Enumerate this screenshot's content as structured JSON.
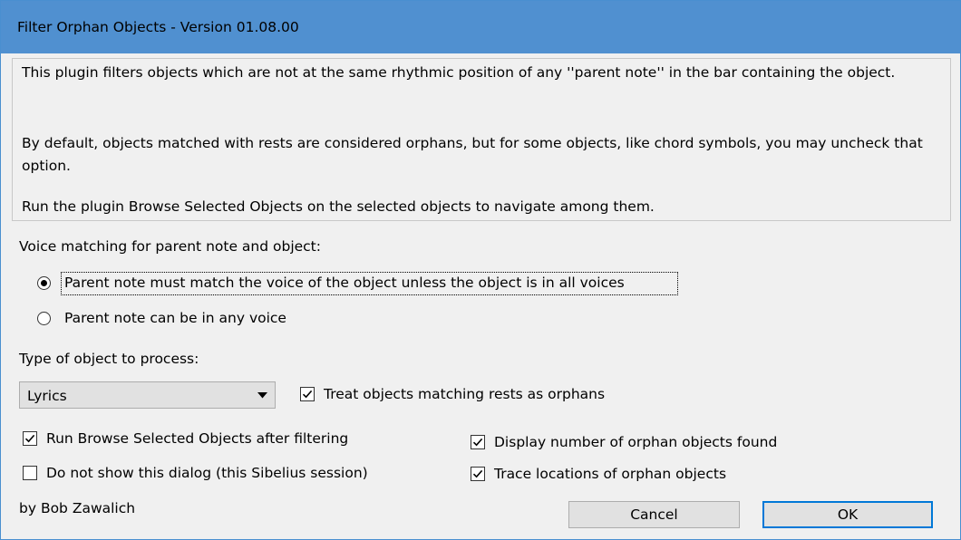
{
  "window": {
    "title": "Filter Orphan Objects - Version 01.08.00"
  },
  "info": {
    "paragraph1": "This plugin filters objects which are not at the same rhythmic position of any ''parent note'' in the bar containing the object.",
    "paragraph2": "By default, objects matched with rests are considered orphans, but for some objects, like chord symbols, you may uncheck that option.",
    "paragraph3": "Run the plugin Browse Selected Objects on the selected objects to navigate among them."
  },
  "voice": {
    "label": "Voice matching for parent note and object:",
    "options": [
      {
        "label": "Parent note must match the voice of the object unless the object is in all voices",
        "selected": true
      },
      {
        "label": "Parent note can be in any voice",
        "selected": false
      }
    ]
  },
  "object_type": {
    "label": "Type of object to process:",
    "selected": "Lyrics"
  },
  "checkboxes": {
    "treat_rests": {
      "label": "Treat objects matching rests as orphans",
      "checked": true
    },
    "run_browse": {
      "label": "Run Browse Selected Objects after filtering",
      "checked": true
    },
    "do_not_show": {
      "label": "Do not show this dialog (this Sibelius session)",
      "checked": false
    },
    "display_number": {
      "label": "Display number of orphan objects found",
      "checked": true
    },
    "trace_locations": {
      "label": "Trace locations of orphan objects",
      "checked": true
    }
  },
  "footer": {
    "author": "by Bob Zawalich",
    "cancel_label": "Cancel",
    "ok_label": "OK"
  },
  "colors": {
    "titlebar": "#5090d0",
    "dialog_bg": "#f0f0f0",
    "button_bg": "#e1e1e1",
    "default_button_border": "#0078d7"
  }
}
